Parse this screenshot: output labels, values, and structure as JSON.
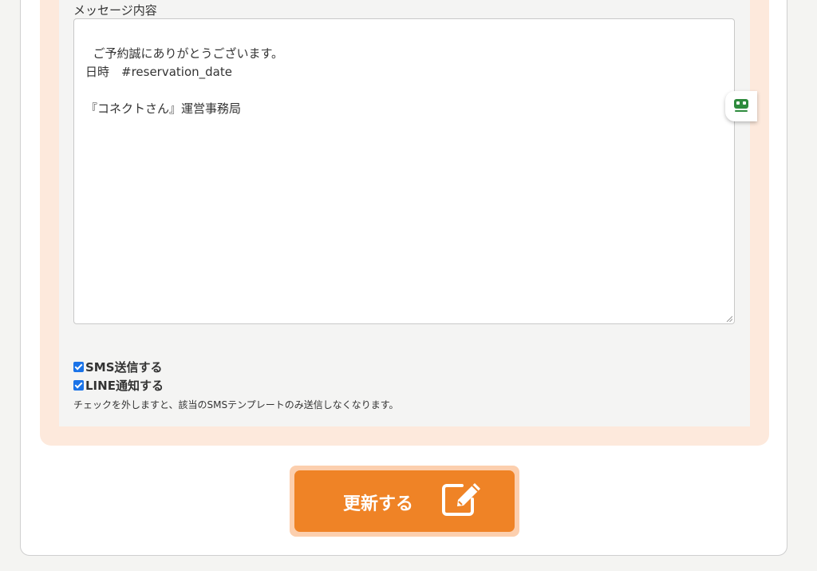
{
  "message": {
    "label": "メッセージ内容",
    "content": "ご予約誠にありがとうございます。\n日時　#reservation_date\n\n『コネクトさん』運営事務局"
  },
  "options": {
    "sms_label": "SMS送信する",
    "sms_checked": true,
    "line_label": "LINE通知する",
    "line_checked": true,
    "note": "チェックを外しますと、該当のSMSテンプレートのみ送信しなくなります。"
  },
  "submit": {
    "label": "更新する",
    "icon": "edit-icon"
  },
  "colors": {
    "accent": "#ef8326",
    "accent_halo": "#fccfae",
    "panel_tint": "#fde9dc",
    "checkbox": "#1a73e8",
    "extension_badge": "#2e8b3d"
  }
}
